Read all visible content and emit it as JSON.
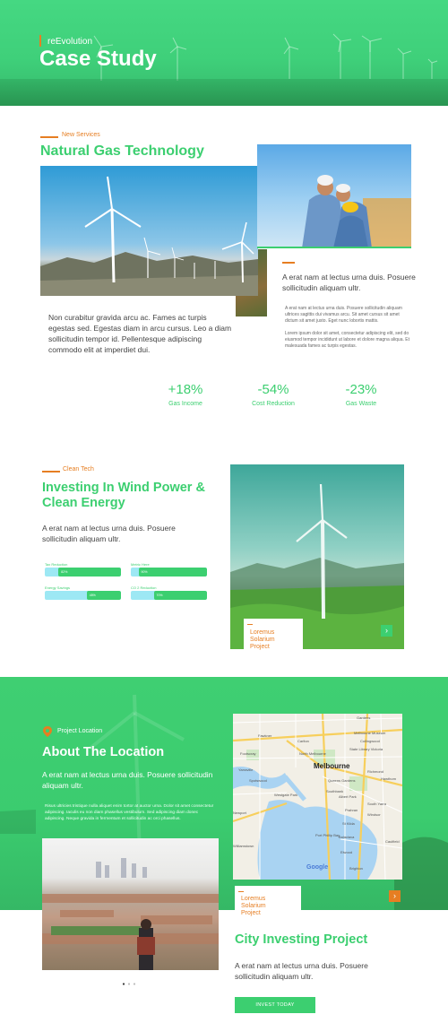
{
  "hero": {
    "brand": "reEvolution",
    "title": "Case Study"
  },
  "section1": {
    "eyebrow": "New Services",
    "heading": "Natural Gas Technology",
    "left_paragraph": "Non curabitur gravida arcu ac. Fames ac turpis egestas sed. Egestas diam in arcu cursus. Leo a diam sollicitudin tempor id. Pellentesque adipiscing commodo elit at imperdiet dui.",
    "right_lead": "A erat nam at lectus urna duis. Posuere sollicitudin aliquam ultr.",
    "right_small_1": "A erat nam at lectus urna duis. Posuere sollicitudin aliquam ultrices sagittis dui vivamus arcu. Sit amet cursus sit amet dictum sit amet justo. Eget nunc lobortis mattis.",
    "right_small_2": "Lorem ipsum dolor sit amet, consectetur adipiscing elit, sed do eiusmod tempor incididunt ut labore et dolore magna aliqua. Et malesuada fames ac turpis egestas.",
    "stats": [
      {
        "value": "+18%",
        "label": "Gas Income"
      },
      {
        "value": "-54%",
        "label": "Cost Reduction"
      },
      {
        "value": "-23%",
        "label": "Gas Waste"
      }
    ]
  },
  "section2": {
    "eyebrow": "Clean Tech",
    "heading_line1": "Investing In Wind Power &",
    "heading_line2": "Clean Energy",
    "lead": "A erat nam at lectus urna duis. Posuere sollicitudin aliquam ultr.",
    "bars": [
      {
        "label": "Tax Reduction",
        "percent": 82,
        "text": "82%"
      },
      {
        "label": "Metric Here",
        "percent": 90,
        "text": "90%"
      },
      {
        "label": "Energy Savings",
        "percent": 45,
        "text": "45%"
      },
      {
        "label": "CO 2 Reduction",
        "percent": 70,
        "text": "70%"
      }
    ],
    "card_title": "Loremus Solarium Project"
  },
  "section3": {
    "eyebrow": "Project Location",
    "heading": "About The Location",
    "lead": "A erat nam at lectus urna duis. Posuere sollicitudin aliquam ultr.",
    "small": "Risus ultricies tristique nulla aliquet enim tortor at auctor urna. Dolor sit amet consectetur adipiscing. Iaculis eu non diam phasellus vestibulum. Sed adipiscing diam donec adipiscing. Neque gravida in fermentum et sollicitudin ac orci phasellus.",
    "map": {
      "city": "Melbourne",
      "labels": [
        "Gardens",
        "Fawkner",
        "Melbourne Museum",
        "Carlton",
        "State Library Victoria",
        "Collingwood",
        "North Melbourne",
        "Footscray",
        "Yarraville",
        "Spotswood",
        "Williamstown",
        "Newport",
        "Queens Gardens",
        "Albert Park",
        "South Yarra",
        "St Kilda",
        "Port Phillip Bay",
        "Richmond",
        "Prahran",
        "Windsor",
        "Balaclava",
        "Elwood",
        "Caulfield",
        "Hawthorn",
        "Westgate Park",
        "Southbank",
        "Brighton"
      ],
      "brand": "Google"
    },
    "card_title": "Loremus Solarium Project",
    "project_heading": "City Investing Project",
    "project_lead": "A erat nam at lectus urna duis. Posuere sollicitudin aliquam ultr.",
    "button": "INVEST TODAY"
  },
  "colors": {
    "accent": "#3ccf70",
    "orange": "#e67e22",
    "bar_bg": "#9de8f4"
  },
  "icons": {
    "arrow": "arrow-right-icon",
    "location": "map-pin-icon"
  }
}
